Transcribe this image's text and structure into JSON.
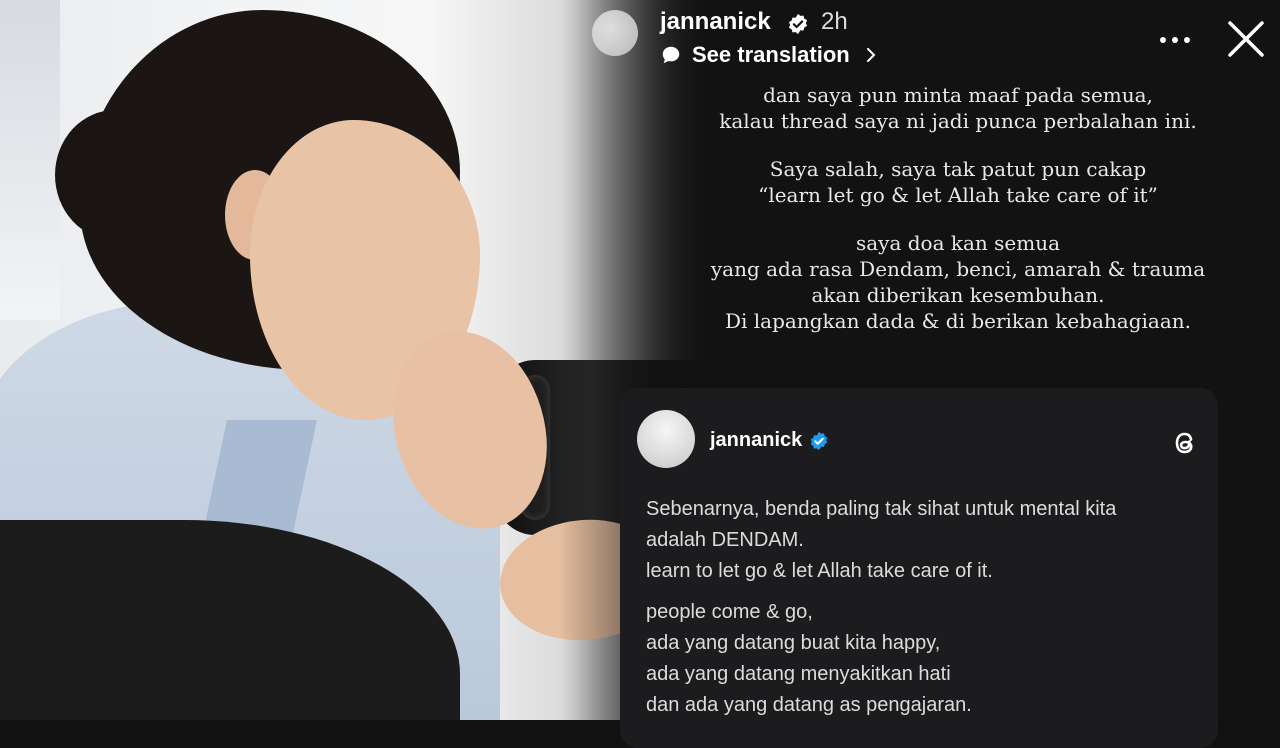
{
  "story": {
    "username": "jannanick",
    "time": "2h",
    "see_translation": "See translation",
    "caption_lines": [
      [
        "dan saya pun minta maaf pada semua,",
        "kalau thread saya ni jadi punca perbalahan ini."
      ],
      [
        "Saya salah, saya tak patut pun cakap",
        "“learn let go & let Allah take care of it”"
      ],
      [
        "saya doa kan semua",
        "yang ada rasa Dendam, benci, amarah & trauma",
        "akan diberikan kesembuhan.",
        "Di lapangkan dada & di berikan kebahagiaan."
      ]
    ]
  },
  "threads_post": {
    "username": "jannanick",
    "lines": [
      "Sebenarnya, benda paling tak sihat untuk mental kita",
      "adalah DENDAM.",
      "learn to let go & let Allah take care of it.",
      "people come & go,",
      "ada yang datang buat kita happy,",
      "ada yang datang menyakitkan hati",
      "dan ada yang datang as pengajaran."
    ]
  },
  "colors": {
    "panel_bg": "#121212",
    "card_bg": "#1c1c1e",
    "verified_blue": "#1d9bf0",
    "text_white": "#ffffff"
  },
  "icons": [
    "verified-badge-icon",
    "translate-icon",
    "chevron-right-icon",
    "more-options-icon",
    "close-icon",
    "threads-logo-icon"
  ]
}
